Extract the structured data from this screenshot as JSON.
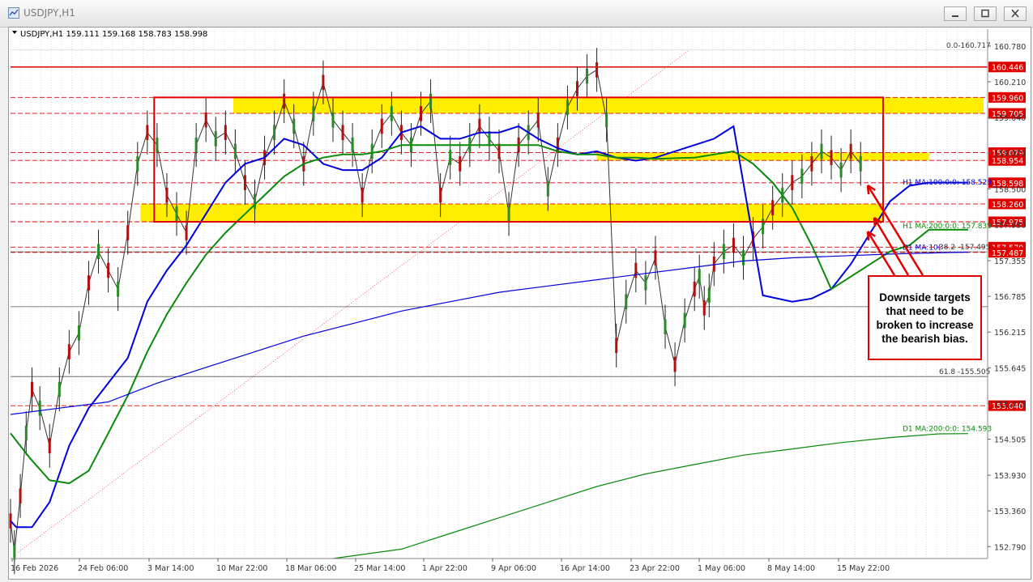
{
  "window": {
    "title": "USDJPY,H1"
  },
  "chart_header": {
    "text": "USDJPY,H1  159.111 159.168 158.783 158.998"
  },
  "colors": {
    "red": "#e00000",
    "yellow": "#ffee00",
    "blue": "#0000dd",
    "green": "#0a8a0a",
    "grid": "#d0d0d0",
    "candle": "#333333"
  },
  "chart_data": {
    "type": "line",
    "ylim": [
      152.6,
      161.05
    ],
    "y_ticks": [
      "160.780",
      "160.210",
      "159.640",
      "159.070",
      "158.500",
      "157.930",
      "157.355",
      "156.785",
      "156.215",
      "155.645",
      "155.075",
      "154.505",
      "153.930",
      "153.360",
      "152.790"
    ],
    "x_ticks": [
      "16 Feb 2026",
      "24 Feb 06:00",
      "3 Mar 14:00",
      "10 Mar 22:00",
      "18 Mar 06:00",
      "25 Mar 14:00",
      "1 Apr 22:00",
      "9 Apr 06:00",
      "16 Apr 14:00",
      "23 Apr 22:00",
      "1 May 06:00",
      "8 May 14:00",
      "15 May 22:00"
    ],
    "price_labels": [
      {
        "text": "160.446",
        "value": 160.446,
        "style": "red"
      },
      {
        "text": "159.960",
        "value": 159.96,
        "style": "red"
      },
      {
        "text": "159.705",
        "value": 159.705,
        "style": "red"
      },
      {
        "text": "159.079",
        "value": 159.079,
        "style": "red"
      },
      {
        "text": "158.954",
        "value": 158.954,
        "style": "red"
      },
      {
        "text": "158.598",
        "value": 158.598,
        "style": "red"
      },
      {
        "text": "158.260",
        "value": 158.26,
        "style": "red"
      },
      {
        "text": "157.975",
        "value": 157.975,
        "style": "red"
      },
      {
        "text": "157.570",
        "value": 157.57,
        "style": "red"
      },
      {
        "text": "157.487",
        "value": 157.487,
        "style": "red"
      },
      {
        "text": "155.040",
        "value": 155.04,
        "style": "red"
      }
    ],
    "horizontal_levels": [
      160.446,
      159.96,
      159.705,
      159.079,
      158.954,
      158.598,
      158.26,
      157.975,
      157.57,
      157.487,
      155.04
    ],
    "fib_labels": [
      {
        "text": "0.0-160.717",
        "value": 160.717
      },
      {
        "text": "38.2 -157.495",
        "value": 157.495
      },
      {
        "text": "61.8 -155.505",
        "value": 155.505
      }
    ],
    "ma_labels": [
      {
        "text": "H1 MA:100:0:0: 158.529",
        "value": 158.529,
        "color": "blue"
      },
      {
        "text": "H1 MA:200:0:0: 157.835",
        "value": 157.835,
        "color": "green"
      },
      {
        "text": "D1 MA:10(",
        "value": 157.49,
        "color": "blue"
      },
      {
        "text": "D1 MA:200:0:0: 154.593",
        "value": 154.593,
        "color": "green"
      }
    ],
    "series": [
      {
        "name": "H1 MA:100:0:0",
        "x": [
          0,
          0.006,
          0.022,
          0.04,
          0.06,
          0.08,
          0.1,
          0.12,
          0.14,
          0.16,
          0.18,
          0.2,
          0.22,
          0.24,
          0.26,
          0.28,
          0.3,
          0.32,
          0.34,
          0.36,
          0.38,
          0.4,
          0.42,
          0.44,
          0.46,
          0.48,
          0.5,
          0.52,
          0.54,
          0.56,
          0.58,
          0.6,
          0.62,
          0.64,
          0.66,
          0.68,
          0.7,
          0.72,
          0.74,
          0.77,
          0.8,
          0.82,
          0.84,
          0.86,
          0.88,
          0.9,
          0.92,
          0.94,
          0.96,
          0.98
        ],
        "values": [
          153.2,
          153.1,
          153.1,
          153.5,
          154.4,
          155.0,
          155.4,
          155.8,
          156.7,
          157.2,
          157.6,
          158.1,
          158.6,
          158.9,
          159.0,
          159.3,
          159.2,
          158.9,
          158.8,
          158.8,
          159.0,
          159.4,
          159.5,
          159.3,
          159.3,
          159.4,
          159.4,
          159.5,
          159.3,
          159.15,
          159.05,
          159.1,
          159.0,
          158.95,
          159.0,
          159.1,
          159.2,
          159.3,
          159.5,
          156.8,
          156.7,
          156.75,
          156.9,
          157.3,
          157.8,
          158.3,
          158.55,
          158.6,
          158.6,
          158.6
        ]
      },
      {
        "name": "H1 MA:200:0:0",
        "x": [
          0,
          0.02,
          0.04,
          0.06,
          0.08,
          0.1,
          0.12,
          0.14,
          0.16,
          0.18,
          0.2,
          0.22,
          0.24,
          0.26,
          0.28,
          0.3,
          0.32,
          0.34,
          0.36,
          0.38,
          0.4,
          0.42,
          0.44,
          0.46,
          0.48,
          0.5,
          0.52,
          0.54,
          0.56,
          0.58,
          0.6,
          0.62,
          0.64,
          0.66,
          0.68,
          0.7,
          0.72,
          0.74,
          0.76,
          0.78,
          0.8,
          0.82,
          0.84,
          0.86,
          0.88,
          0.9,
          0.92,
          0.94,
          0.96,
          0.98
        ],
        "values": [
          154.6,
          154.2,
          153.85,
          153.8,
          154.0,
          154.6,
          155.2,
          155.9,
          156.5,
          157.0,
          157.45,
          157.8,
          158.1,
          158.4,
          158.7,
          158.9,
          159.0,
          159.05,
          159.05,
          159.1,
          159.2,
          159.2,
          159.2,
          159.2,
          159.2,
          159.2,
          159.2,
          159.2,
          159.1,
          159.05,
          159.05,
          159.0,
          159.0,
          158.98,
          158.99,
          159.0,
          159.05,
          159.1,
          158.9,
          158.6,
          158.2,
          157.6,
          156.9,
          157.1,
          157.3,
          157.5,
          157.6,
          157.85,
          157.85,
          157.85
        ]
      },
      {
        "name": "D1 MA:100",
        "x": [
          0,
          0.05,
          0.1,
          0.15,
          0.2,
          0.25,
          0.3,
          0.35,
          0.4,
          0.45,
          0.5,
          0.55,
          0.6,
          0.65,
          0.7,
          0.75,
          0.8,
          0.85,
          0.9,
          0.95,
          0.98
        ],
        "values": [
          154.9,
          155.0,
          155.1,
          155.4,
          155.65,
          155.9,
          156.15,
          156.35,
          156.55,
          156.7,
          156.85,
          156.95,
          157.05,
          157.15,
          157.25,
          157.35,
          157.4,
          157.43,
          157.46,
          157.48,
          157.49
        ]
      },
      {
        "name": "D1 MA:200:0:0",
        "x": [
          0.33,
          0.4,
          0.45,
          0.5,
          0.55,
          0.6,
          0.65,
          0.7,
          0.75,
          0.8,
          0.85,
          0.9,
          0.95,
          0.98
        ],
        "values": [
          152.6,
          152.75,
          153.0,
          153.25,
          153.5,
          153.75,
          153.95,
          154.1,
          154.25,
          154.35,
          154.45,
          154.53,
          154.59,
          154.593
        ]
      }
    ],
    "candle_path": {
      "x": [
        0,
        0.004,
        0.01,
        0.016,
        0.022,
        0.03,
        0.04,
        0.05,
        0.06,
        0.07,
        0.08,
        0.09,
        0.1,
        0.11,
        0.12,
        0.13,
        0.14,
        0.15,
        0.16,
        0.17,
        0.18,
        0.19,
        0.2,
        0.21,
        0.22,
        0.23,
        0.24,
        0.25,
        0.26,
        0.27,
        0.28,
        0.29,
        0.3,
        0.31,
        0.32,
        0.33,
        0.34,
        0.35,
        0.36,
        0.37,
        0.38,
        0.39,
        0.4,
        0.41,
        0.42,
        0.43,
        0.44,
        0.45,
        0.46,
        0.47,
        0.48,
        0.49,
        0.5,
        0.51,
        0.52,
        0.53,
        0.54,
        0.55,
        0.56,
        0.57,
        0.58,
        0.59,
        0.6,
        0.61,
        0.62,
        0.63,
        0.64,
        0.65,
        0.66,
        0.67,
        0.68,
        0.69,
        0.7,
        0.705,
        0.71,
        0.715,
        0.72,
        0.73,
        0.74,
        0.75,
        0.76,
        0.77,
        0.78,
        0.79,
        0.8,
        0.81,
        0.82,
        0.83,
        0.84,
        0.85,
        0.86,
        0.87,
        0.88,
        0.89,
        0.9,
        0.91,
        0.92,
        0.93,
        0.94,
        0.95,
        0.96,
        0.97,
        0.975,
        0.98
      ],
      "values": [
        153.2,
        152.7,
        153.6,
        154.6,
        155.3,
        155.0,
        154.4,
        155.3,
        155.9,
        156.2,
        157.0,
        157.5,
        157.2,
        156.9,
        157.8,
        158.9,
        159.4,
        159.2,
        158.4,
        158.1,
        157.8,
        159.2,
        159.6,
        159.3,
        159.4,
        159.1,
        158.6,
        158.3,
        159.0,
        159.4,
        159.9,
        159.5,
        158.9,
        159.7,
        160.2,
        159.6,
        159.4,
        159.2,
        158.4,
        159.1,
        159.5,
        159.7,
        159.4,
        159.2,
        159.7,
        159.9,
        158.4,
        159.0,
        158.9,
        159.2,
        159.5,
        159.3,
        159.1,
        158.1,
        159.2,
        159.4,
        159.6,
        158.5,
        159.2,
        159.8,
        160.1,
        160.3,
        160.4,
        159.6,
        156.0,
        156.7,
        157.2,
        157.0,
        157.4,
        156.3,
        155.7,
        156.4,
        156.9,
        157.1,
        156.6,
        156.8,
        157.3,
        157.5,
        157.6,
        157.4,
        157.7,
        157.9,
        158.2,
        158.4,
        158.6,
        158.7,
        158.9,
        159.1,
        159.0,
        158.8,
        159.1,
        158.9
      ],
      "_unused": null
    },
    "annotation": "Downside targets that need to be broken to increase the bearish bias."
  }
}
